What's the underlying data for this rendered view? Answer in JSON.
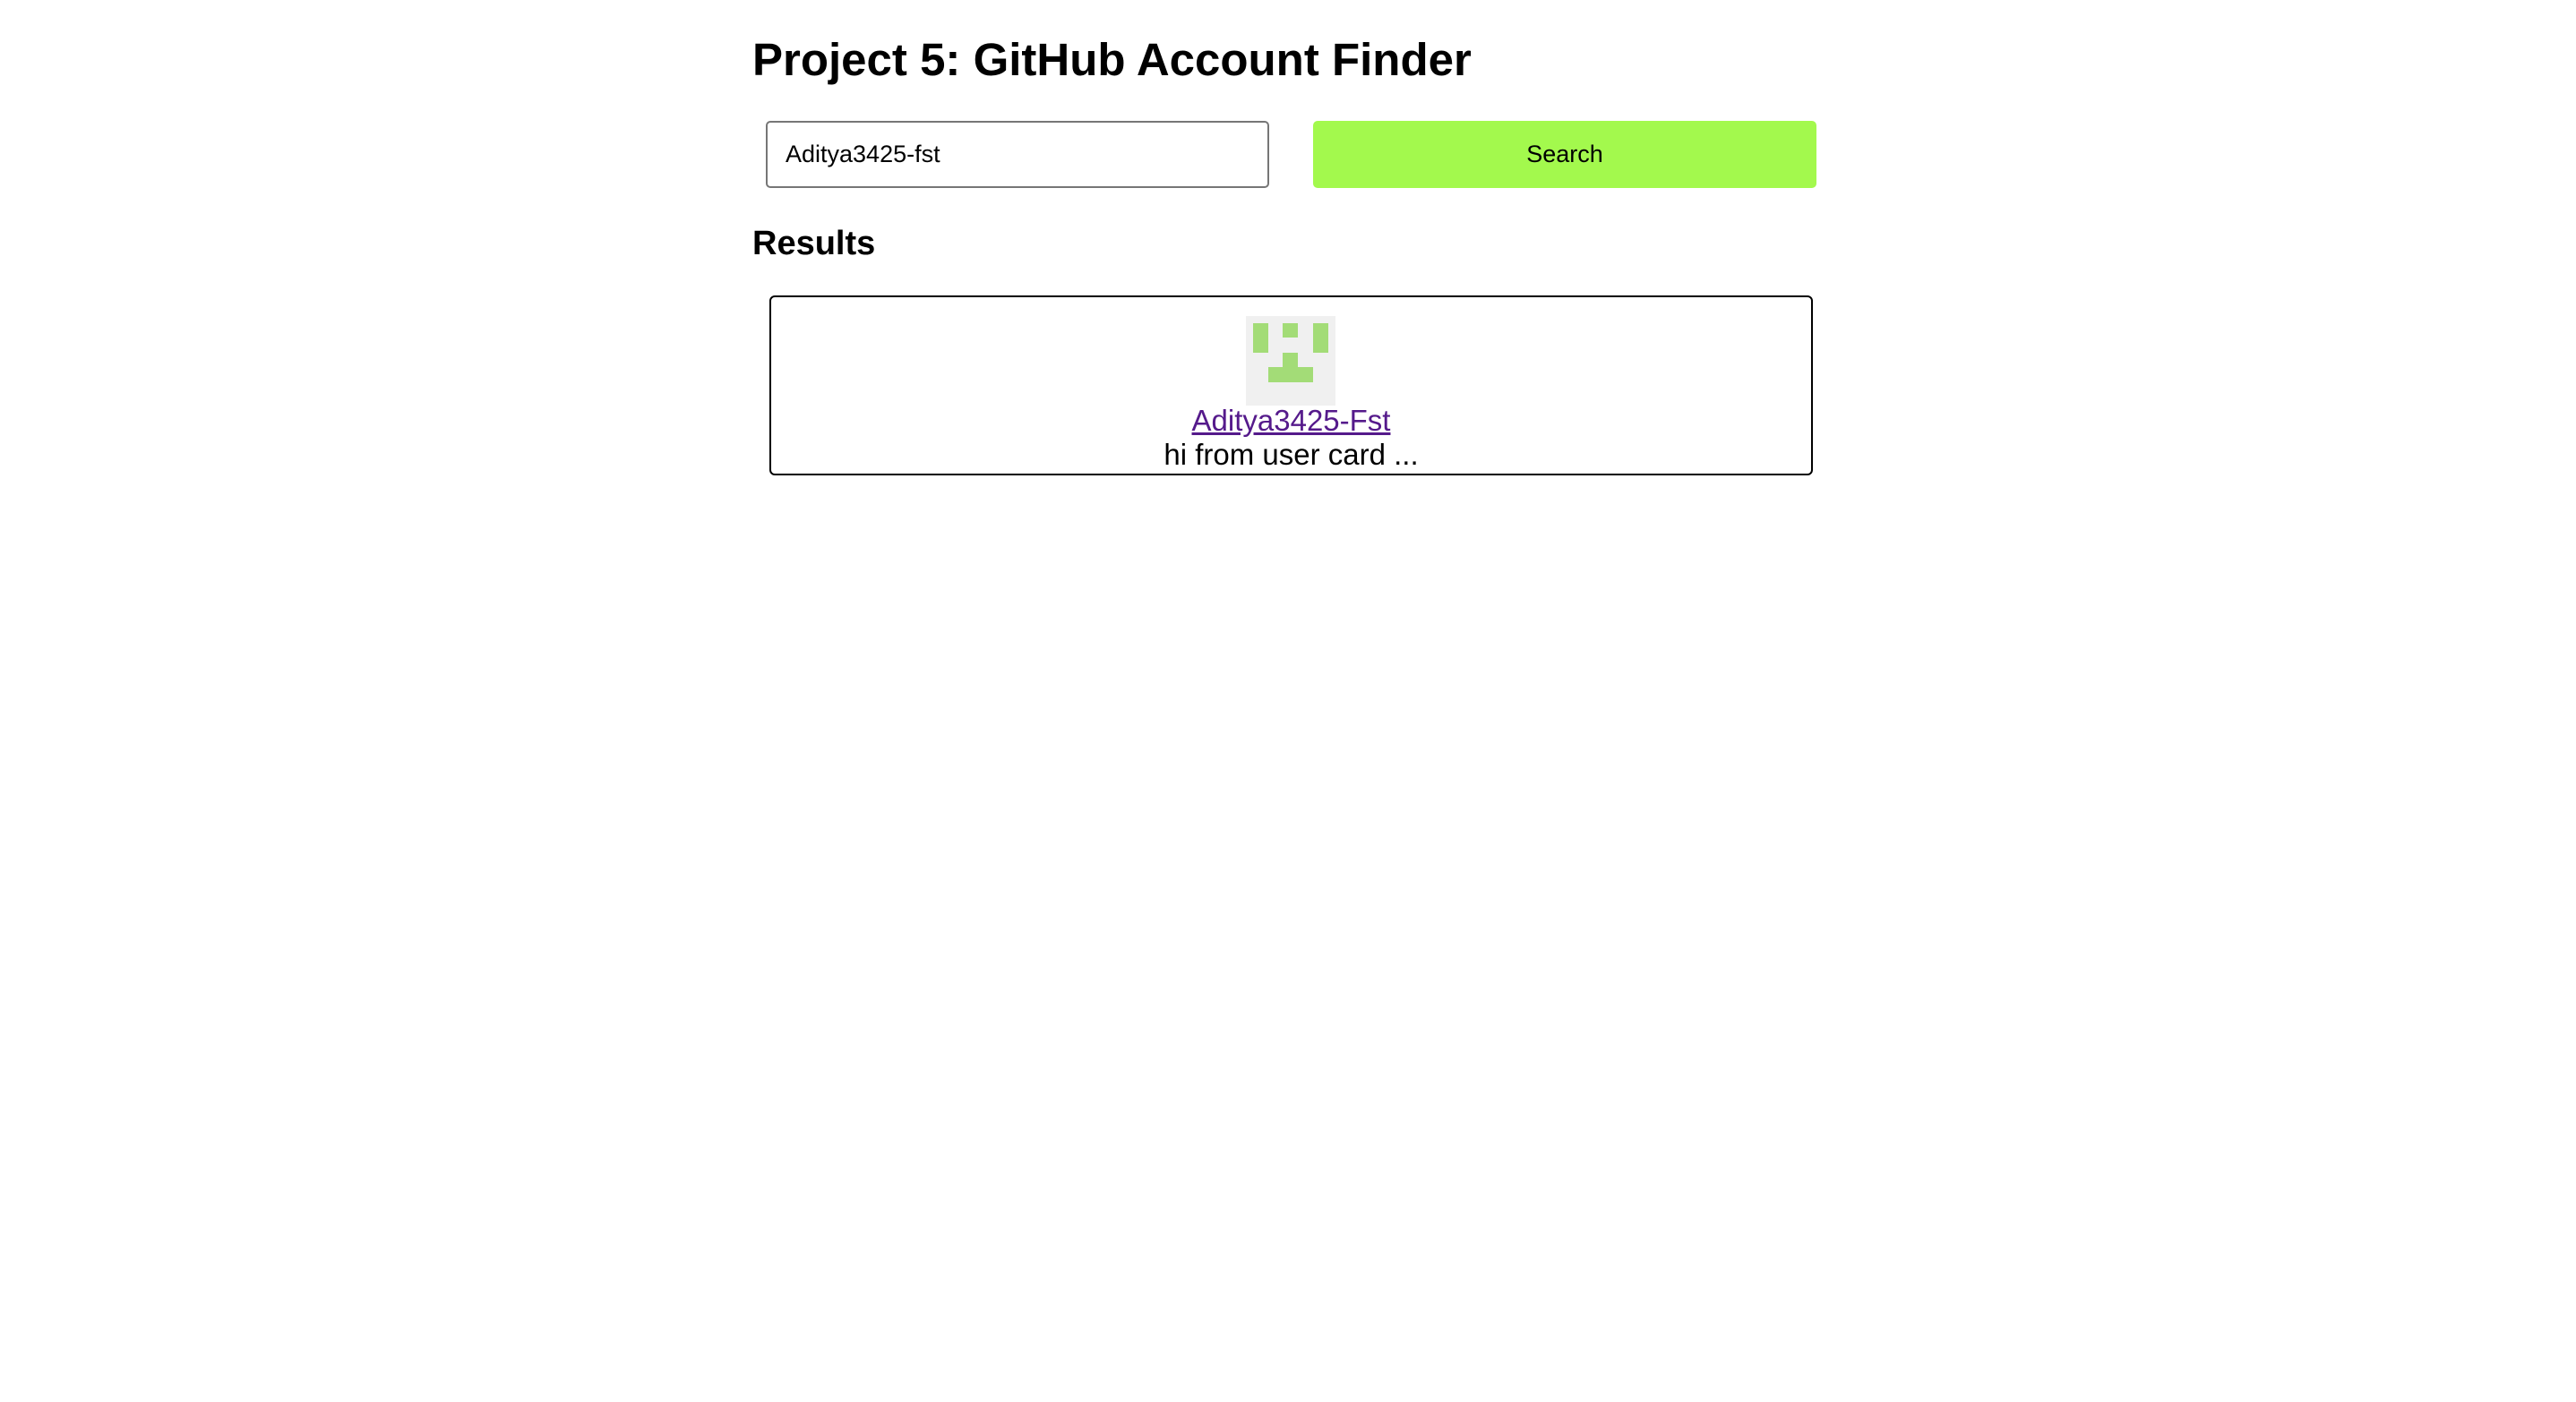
{
  "page": {
    "title": "Project 5: GitHub Account Finder"
  },
  "search": {
    "value": "Aditya3425-fst",
    "button_label": "Search",
    "button_color": "#a3f94d"
  },
  "results": {
    "heading": "Results",
    "cards": [
      {
        "username": "Aditya3425-Fst",
        "bio": "hi from user card ...",
        "avatar_icon": "identicon-avatar",
        "avatar_color": "#a3dc77",
        "link_color": "#551a8b"
      }
    ]
  }
}
